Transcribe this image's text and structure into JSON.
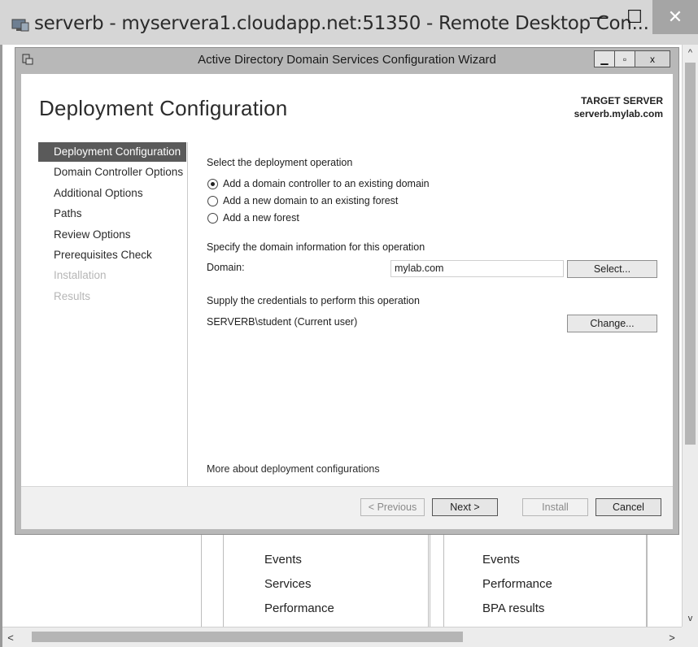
{
  "rdp": {
    "title": "serverb - myservera1.cloudapp.net:51350 - Remote Desktop Con...",
    "minimize": "—",
    "maximize": "☐",
    "close": "✕"
  },
  "wizard": {
    "title": "Active Directory Domain Services Configuration Wizard",
    "minimize": "▁",
    "maximize": "▫",
    "close": "x",
    "page_title": "Deployment Configuration",
    "target_label": "TARGET SERVER",
    "target_server": "serverb.mylab.com",
    "nav": [
      {
        "label": "Deployment Configuration",
        "state": "active"
      },
      {
        "label": "Domain Controller Options",
        "state": "normal"
      },
      {
        "label": "Additional Options",
        "state": "normal"
      },
      {
        "label": "Paths",
        "state": "normal"
      },
      {
        "label": "Review Options",
        "state": "normal"
      },
      {
        "label": "Prerequisites Check",
        "state": "normal"
      },
      {
        "label": "Installation",
        "state": "disabled"
      },
      {
        "label": "Results",
        "state": "disabled"
      }
    ],
    "deployment": {
      "heading": "Select the deployment operation",
      "options": [
        {
          "label": "Add a domain controller to an existing domain",
          "checked": true
        },
        {
          "label": "Add a new domain to an existing forest",
          "checked": false
        },
        {
          "label": "Add a new forest",
          "checked": false
        }
      ]
    },
    "domain_info": {
      "heading": "Specify the domain information for this operation",
      "domain_label": "Domain:",
      "domain_value": "mylab.com",
      "select_button": "Select..."
    },
    "credentials": {
      "heading": "Supply the credentials to perform this operation",
      "user": "SERVERB\\student (Current user)",
      "change_button": "Change..."
    },
    "more_link": "More about deployment configurations",
    "buttons": {
      "previous": "< Previous",
      "next": "Next >",
      "install": "Install",
      "cancel": "Cancel"
    }
  },
  "background": {
    "col1": [
      "Events",
      "Services",
      "Performance"
    ],
    "col2": [
      "Events",
      "Performance",
      "BPA results"
    ]
  },
  "scroll": {
    "up": "^",
    "down": "v",
    "left": "<",
    "right": ">"
  }
}
